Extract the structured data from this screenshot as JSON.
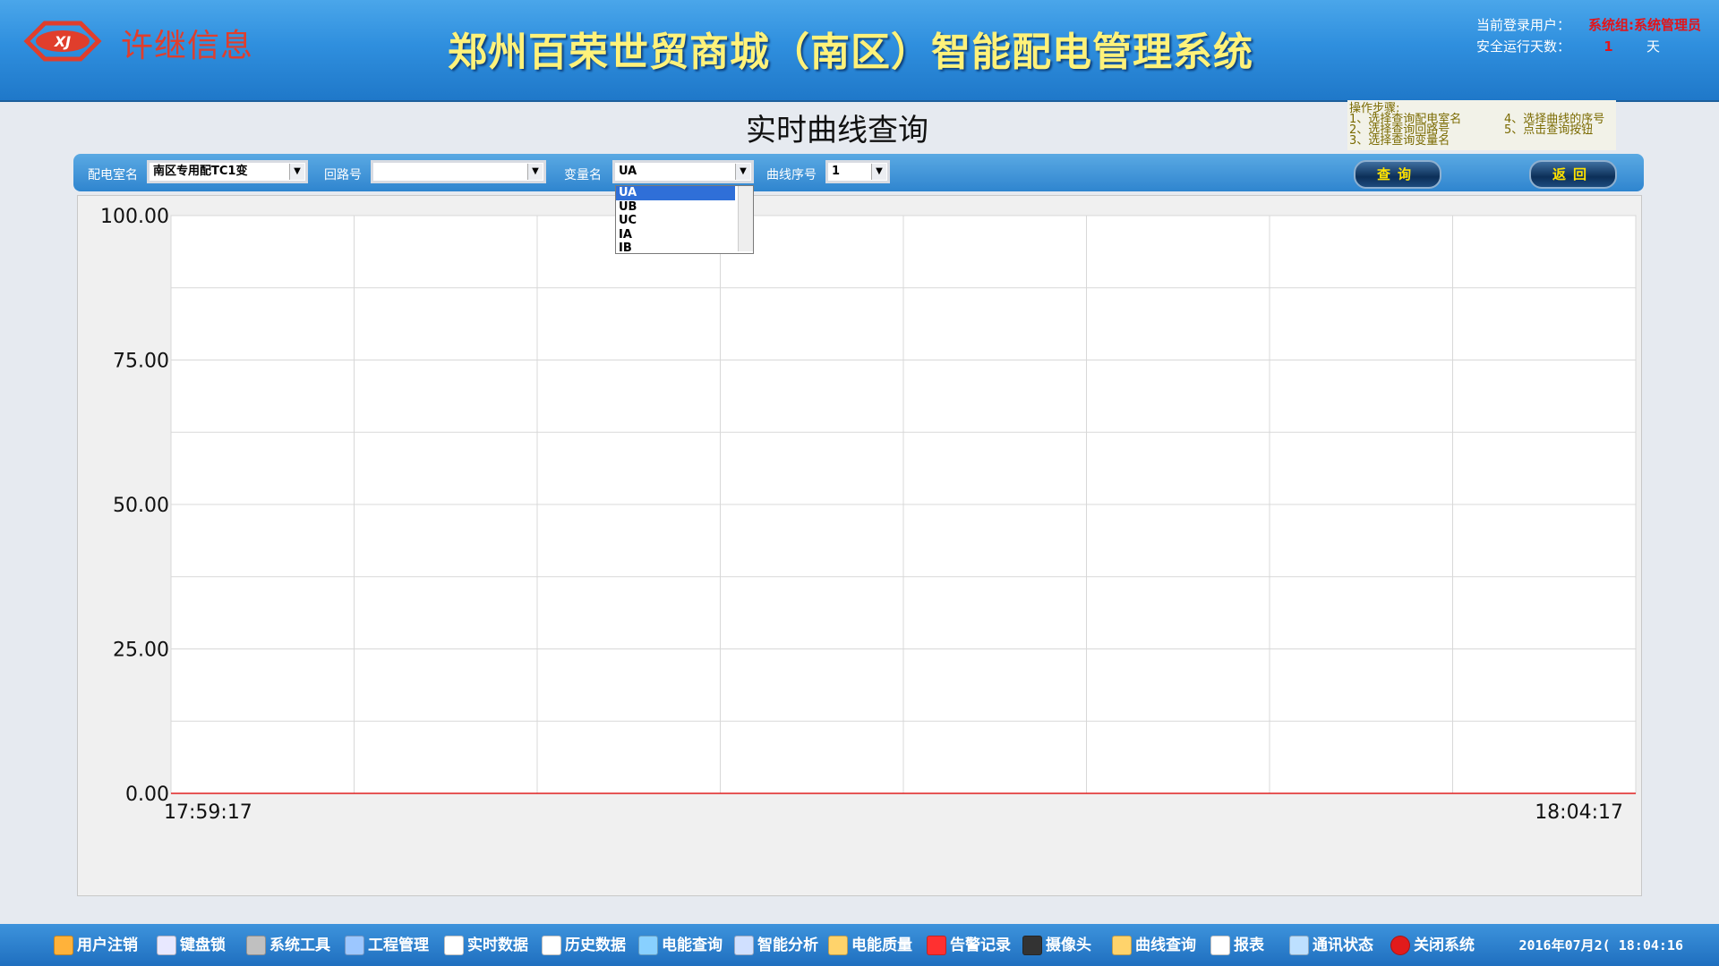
{
  "header": {
    "logo_text": "许继信息",
    "title": "郑州百荣世贸商城（南区）智能配电管理系统",
    "user_label": "当前登录用户：",
    "user_value": "系统组:系统管理员",
    "days_label": "安全运行天数：",
    "days_value": "1",
    "days_unit": "天"
  },
  "page": {
    "title": "实时曲线查询"
  },
  "steps": {
    "heading": "操作步骤:",
    "items_left": [
      "1、选择查询配电室名",
      "2、选择查询回路号",
      "3、选择查询变量名"
    ],
    "items_right": [
      "4、选择曲线的序号",
      "5、点击查询按钮"
    ]
  },
  "toolbar": {
    "room_label": "配电室名",
    "room_value": "南区专用配TC1变",
    "loop_label": "回路号",
    "loop_value": "",
    "var_label": "变量名",
    "var_value": "UA",
    "curve_label": "曲线序号",
    "curve_value": "1",
    "query_button": "查询",
    "back_button": "返回"
  },
  "var_dropdown": {
    "options": [
      "UA",
      "UB",
      "UC",
      "IA",
      "IB"
    ],
    "selected": "UA"
  },
  "chart_data": {
    "type": "line",
    "y_ticks": [
      "100.00",
      "75.00",
      "50.00",
      "25.00",
      "0.00"
    ],
    "ylim": [
      0,
      100
    ],
    "x_start_label": "17:59:17",
    "x_end_label": "18:04:17",
    "grid": true,
    "series": [
      {
        "values": [
          0,
          0
        ],
        "color": "#e02020"
      }
    ]
  },
  "taskbar": {
    "items": [
      {
        "label": "用户注销",
        "icon": "users-icon"
      },
      {
        "label": "键盘锁",
        "icon": "keyboard-icon"
      },
      {
        "label": "系统工具",
        "icon": "tools-icon"
      },
      {
        "label": "工程管理",
        "icon": "project-icon"
      },
      {
        "label": "实时数据",
        "icon": "realtime-data-icon"
      },
      {
        "label": "历史数据",
        "icon": "history-data-icon"
      },
      {
        "label": "电能查询",
        "icon": "energy-query-icon"
      },
      {
        "label": "智能分析",
        "icon": "analysis-icon"
      },
      {
        "label": "电能质量",
        "icon": "power-quality-icon"
      },
      {
        "label": "告警记录",
        "icon": "alarm-icon"
      },
      {
        "label": "摄像头",
        "icon": "camera-icon"
      },
      {
        "label": "曲线查询",
        "icon": "curve-query-icon"
      },
      {
        "label": "报表",
        "icon": "report-icon"
      },
      {
        "label": "通讯状态",
        "icon": "network-icon"
      },
      {
        "label": "关闭系统",
        "icon": "close-icon"
      }
    ],
    "datetime": "2016年07月2( 18:04:16"
  }
}
